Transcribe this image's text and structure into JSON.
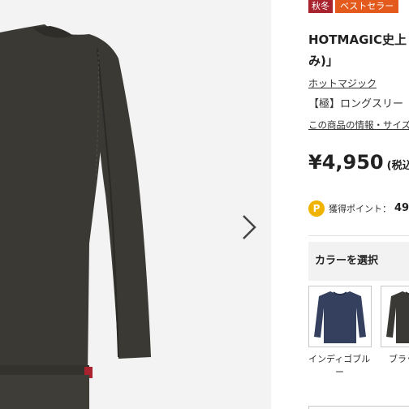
{
  "gallery": {
    "image_icon": "long-sleeve-thermal-shirt-photo",
    "next_icon": "chevron-right-icon"
  },
  "badges": {
    "season": "秋冬",
    "best_seller": "ベストセラー"
  },
  "product": {
    "title_line1": "HOTMAGIC史上",
    "title_line2": "み)」",
    "brand": "ホットマジック",
    "subtitle": "【極】ロングスリー",
    "detail_link": "この商品の情報・サイズ",
    "price": "¥4,950",
    "tax_note": "(税込"
  },
  "points": {
    "icon_letter": "P",
    "label": "獲得ポイント：",
    "value": "49"
  },
  "color_select": {
    "heading": "カラーを選択",
    "options": [
      {
        "label": "インディゴブル",
        "label_cont": "ー",
        "color": "#34405e"
      },
      {
        "label": "ブラッ",
        "color": "#3a3935"
      }
    ]
  },
  "colors": {
    "season_badge": "#a8232d",
    "best_badge": "#e35a1c",
    "point_icon": "#f0b400",
    "shirt": "#3b3934"
  }
}
